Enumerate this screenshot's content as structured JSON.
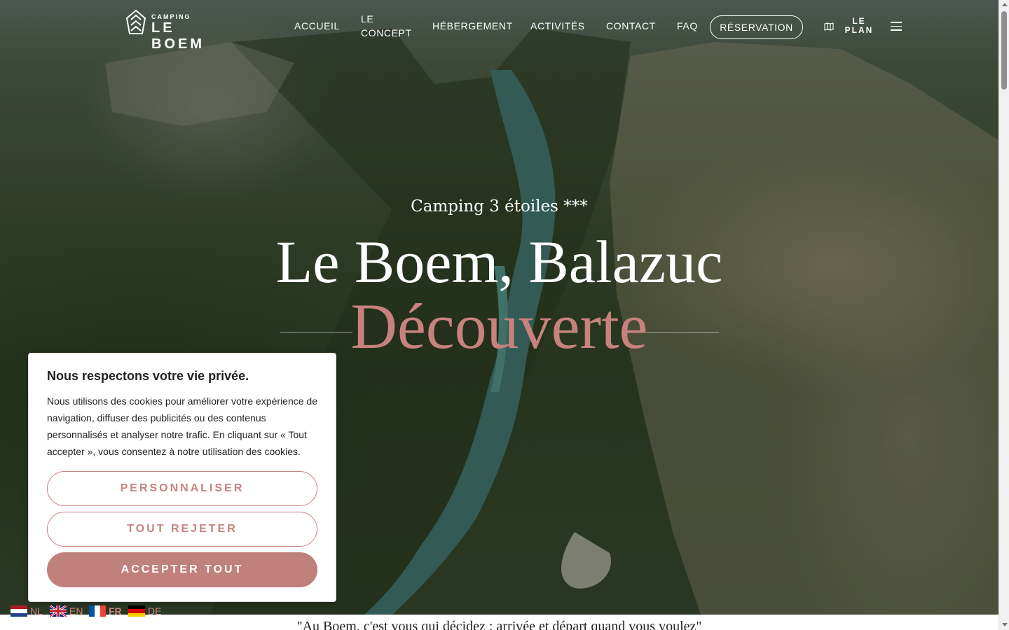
{
  "nav": {
    "logo_small": "CAMPING",
    "logo_big": "LE BOEM",
    "links": [
      {
        "label": "ACCUEIL"
      },
      {
        "label": "LE CONCEPT"
      },
      {
        "label": "HÉBERGEMENT"
      },
      {
        "label": "ACTIVITÉS"
      },
      {
        "label": "CONTACT"
      },
      {
        "label": "FAQ"
      }
    ],
    "reservation_label": "RÉSERVATION",
    "plan_label": "LE PLAN",
    "plan_icon": "map-icon",
    "menu_icon": "hamburger-menu-icon"
  },
  "hero": {
    "subtitle": "Camping 3 étoiles ***",
    "title": "Le Boem, Balazuc",
    "accent": "Découverte"
  },
  "cookie": {
    "title": "Nous respectons votre vie privée.",
    "text": "Nous utilisons des cookies pour améliorer votre expérience de navigation, diffuser des publicités ou des contenus personnalisés et analyser notre trafic. En cliquant sur « Tout accepter », vous consentez à notre utilisation des cookies.",
    "customize_label": "PERSONNALISER",
    "reject_label": "TOUT REJETER",
    "accept_label": "ACCEPTER TOUT"
  },
  "languages": [
    {
      "code": "NL"
    },
    {
      "code": "EN"
    },
    {
      "code": "FR"
    },
    {
      "code": "DE"
    }
  ],
  "quote": "\"Au Boem, c'est vous qui décidez : arrivée et départ quand vous voulez\"",
  "colors": {
    "accent": "#c8827e",
    "accent_button": "#c0807c",
    "text_dark": "#222222"
  }
}
